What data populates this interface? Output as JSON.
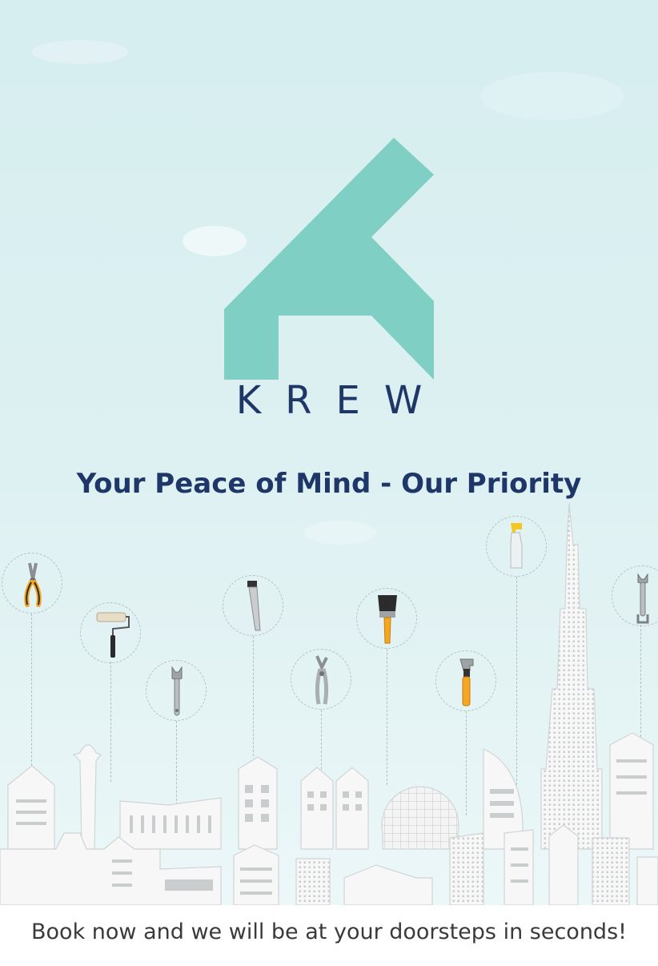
{
  "brand": {
    "name": "KREW",
    "logo": "house-k-logo",
    "color": "#7fcfc5"
  },
  "tagline": "Your Peace of Mind - Our Priority",
  "footer": {
    "text": "Book now and we will be at your doorsteps in seconds!"
  },
  "tools": [
    {
      "icon": "pliers-icon"
    },
    {
      "icon": "paint-roller-icon"
    },
    {
      "icon": "adjustable-wrench-icon"
    },
    {
      "icon": "hand-saw-icon"
    },
    {
      "icon": "locking-pliers-icon"
    },
    {
      "icon": "paint-brush-icon"
    },
    {
      "icon": "pipe-wrench-icon"
    },
    {
      "icon": "spray-bottle-icon"
    },
    {
      "icon": "spanner-icon"
    }
  ],
  "colors": {
    "text_dark": "#1f3768",
    "accent": "#7fcfc5",
    "tool_orange": "#f5a623",
    "background": "#dcf0f1"
  }
}
